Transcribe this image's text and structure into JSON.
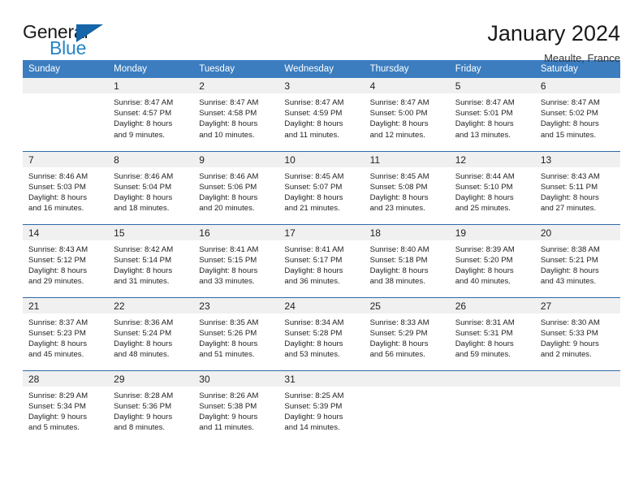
{
  "brand": {
    "name_top": "General",
    "name_bottom": "Blue",
    "accent_color": "#2585c7",
    "triangle_color": "#1565a8"
  },
  "header": {
    "title": "January 2024",
    "subtitle": "Meaulte, France"
  },
  "theme": {
    "header_row_color": "#3b7dbf",
    "row_divider_color": "#2d6ca8",
    "daynum_band_color": "#f0f0f0"
  },
  "weekdays": [
    "Sunday",
    "Monday",
    "Tuesday",
    "Wednesday",
    "Thursday",
    "Friday",
    "Saturday"
  ],
  "weeks": [
    [
      {
        "date": "",
        "sunrise": "",
        "sunset": "",
        "daylight_line1": "",
        "daylight_line2": ""
      },
      {
        "date": "1",
        "sunrise": "Sunrise: 8:47 AM",
        "sunset": "Sunset: 4:57 PM",
        "daylight_line1": "Daylight: 8 hours",
        "daylight_line2": "and 9 minutes."
      },
      {
        "date": "2",
        "sunrise": "Sunrise: 8:47 AM",
        "sunset": "Sunset: 4:58 PM",
        "daylight_line1": "Daylight: 8 hours",
        "daylight_line2": "and 10 minutes."
      },
      {
        "date": "3",
        "sunrise": "Sunrise: 8:47 AM",
        "sunset": "Sunset: 4:59 PM",
        "daylight_line1": "Daylight: 8 hours",
        "daylight_line2": "and 11 minutes."
      },
      {
        "date": "4",
        "sunrise": "Sunrise: 8:47 AM",
        "sunset": "Sunset: 5:00 PM",
        "daylight_line1": "Daylight: 8 hours",
        "daylight_line2": "and 12 minutes."
      },
      {
        "date": "5",
        "sunrise": "Sunrise: 8:47 AM",
        "sunset": "Sunset: 5:01 PM",
        "daylight_line1": "Daylight: 8 hours",
        "daylight_line2": "and 13 minutes."
      },
      {
        "date": "6",
        "sunrise": "Sunrise: 8:47 AM",
        "sunset": "Sunset: 5:02 PM",
        "daylight_line1": "Daylight: 8 hours",
        "daylight_line2": "and 15 minutes."
      }
    ],
    [
      {
        "date": "7",
        "sunrise": "Sunrise: 8:46 AM",
        "sunset": "Sunset: 5:03 PM",
        "daylight_line1": "Daylight: 8 hours",
        "daylight_line2": "and 16 minutes."
      },
      {
        "date": "8",
        "sunrise": "Sunrise: 8:46 AM",
        "sunset": "Sunset: 5:04 PM",
        "daylight_line1": "Daylight: 8 hours",
        "daylight_line2": "and 18 minutes."
      },
      {
        "date": "9",
        "sunrise": "Sunrise: 8:46 AM",
        "sunset": "Sunset: 5:06 PM",
        "daylight_line1": "Daylight: 8 hours",
        "daylight_line2": "and 20 minutes."
      },
      {
        "date": "10",
        "sunrise": "Sunrise: 8:45 AM",
        "sunset": "Sunset: 5:07 PM",
        "daylight_line1": "Daylight: 8 hours",
        "daylight_line2": "and 21 minutes."
      },
      {
        "date": "11",
        "sunrise": "Sunrise: 8:45 AM",
        "sunset": "Sunset: 5:08 PM",
        "daylight_line1": "Daylight: 8 hours",
        "daylight_line2": "and 23 minutes."
      },
      {
        "date": "12",
        "sunrise": "Sunrise: 8:44 AM",
        "sunset": "Sunset: 5:10 PM",
        "daylight_line1": "Daylight: 8 hours",
        "daylight_line2": "and 25 minutes."
      },
      {
        "date": "13",
        "sunrise": "Sunrise: 8:43 AM",
        "sunset": "Sunset: 5:11 PM",
        "daylight_line1": "Daylight: 8 hours",
        "daylight_line2": "and 27 minutes."
      }
    ],
    [
      {
        "date": "14",
        "sunrise": "Sunrise: 8:43 AM",
        "sunset": "Sunset: 5:12 PM",
        "daylight_line1": "Daylight: 8 hours",
        "daylight_line2": "and 29 minutes."
      },
      {
        "date": "15",
        "sunrise": "Sunrise: 8:42 AM",
        "sunset": "Sunset: 5:14 PM",
        "daylight_line1": "Daylight: 8 hours",
        "daylight_line2": "and 31 minutes."
      },
      {
        "date": "16",
        "sunrise": "Sunrise: 8:41 AM",
        "sunset": "Sunset: 5:15 PM",
        "daylight_line1": "Daylight: 8 hours",
        "daylight_line2": "and 33 minutes."
      },
      {
        "date": "17",
        "sunrise": "Sunrise: 8:41 AM",
        "sunset": "Sunset: 5:17 PM",
        "daylight_line1": "Daylight: 8 hours",
        "daylight_line2": "and 36 minutes."
      },
      {
        "date": "18",
        "sunrise": "Sunrise: 8:40 AM",
        "sunset": "Sunset: 5:18 PM",
        "daylight_line1": "Daylight: 8 hours",
        "daylight_line2": "and 38 minutes."
      },
      {
        "date": "19",
        "sunrise": "Sunrise: 8:39 AM",
        "sunset": "Sunset: 5:20 PM",
        "daylight_line1": "Daylight: 8 hours",
        "daylight_line2": "and 40 minutes."
      },
      {
        "date": "20",
        "sunrise": "Sunrise: 8:38 AM",
        "sunset": "Sunset: 5:21 PM",
        "daylight_line1": "Daylight: 8 hours",
        "daylight_line2": "and 43 minutes."
      }
    ],
    [
      {
        "date": "21",
        "sunrise": "Sunrise: 8:37 AM",
        "sunset": "Sunset: 5:23 PM",
        "daylight_line1": "Daylight: 8 hours",
        "daylight_line2": "and 45 minutes."
      },
      {
        "date": "22",
        "sunrise": "Sunrise: 8:36 AM",
        "sunset": "Sunset: 5:24 PM",
        "daylight_line1": "Daylight: 8 hours",
        "daylight_line2": "and 48 minutes."
      },
      {
        "date": "23",
        "sunrise": "Sunrise: 8:35 AM",
        "sunset": "Sunset: 5:26 PM",
        "daylight_line1": "Daylight: 8 hours",
        "daylight_line2": "and 51 minutes."
      },
      {
        "date": "24",
        "sunrise": "Sunrise: 8:34 AM",
        "sunset": "Sunset: 5:28 PM",
        "daylight_line1": "Daylight: 8 hours",
        "daylight_line2": "and 53 minutes."
      },
      {
        "date": "25",
        "sunrise": "Sunrise: 8:33 AM",
        "sunset": "Sunset: 5:29 PM",
        "daylight_line1": "Daylight: 8 hours",
        "daylight_line2": "and 56 minutes."
      },
      {
        "date": "26",
        "sunrise": "Sunrise: 8:31 AM",
        "sunset": "Sunset: 5:31 PM",
        "daylight_line1": "Daylight: 8 hours",
        "daylight_line2": "and 59 minutes."
      },
      {
        "date": "27",
        "sunrise": "Sunrise: 8:30 AM",
        "sunset": "Sunset: 5:33 PM",
        "daylight_line1": "Daylight: 9 hours",
        "daylight_line2": "and 2 minutes."
      }
    ],
    [
      {
        "date": "28",
        "sunrise": "Sunrise: 8:29 AM",
        "sunset": "Sunset: 5:34 PM",
        "daylight_line1": "Daylight: 9 hours",
        "daylight_line2": "and 5 minutes."
      },
      {
        "date": "29",
        "sunrise": "Sunrise: 8:28 AM",
        "sunset": "Sunset: 5:36 PM",
        "daylight_line1": "Daylight: 9 hours",
        "daylight_line2": "and 8 minutes."
      },
      {
        "date": "30",
        "sunrise": "Sunrise: 8:26 AM",
        "sunset": "Sunset: 5:38 PM",
        "daylight_line1": "Daylight: 9 hours",
        "daylight_line2": "and 11 minutes."
      },
      {
        "date": "31",
        "sunrise": "Sunrise: 8:25 AM",
        "sunset": "Sunset: 5:39 PM",
        "daylight_line1": "Daylight: 9 hours",
        "daylight_line2": "and 14 minutes."
      },
      {
        "date": "",
        "sunrise": "",
        "sunset": "",
        "daylight_line1": "",
        "daylight_line2": ""
      },
      {
        "date": "",
        "sunrise": "",
        "sunset": "",
        "daylight_line1": "",
        "daylight_line2": ""
      },
      {
        "date": "",
        "sunrise": "",
        "sunset": "",
        "daylight_line1": "",
        "daylight_line2": ""
      }
    ]
  ]
}
